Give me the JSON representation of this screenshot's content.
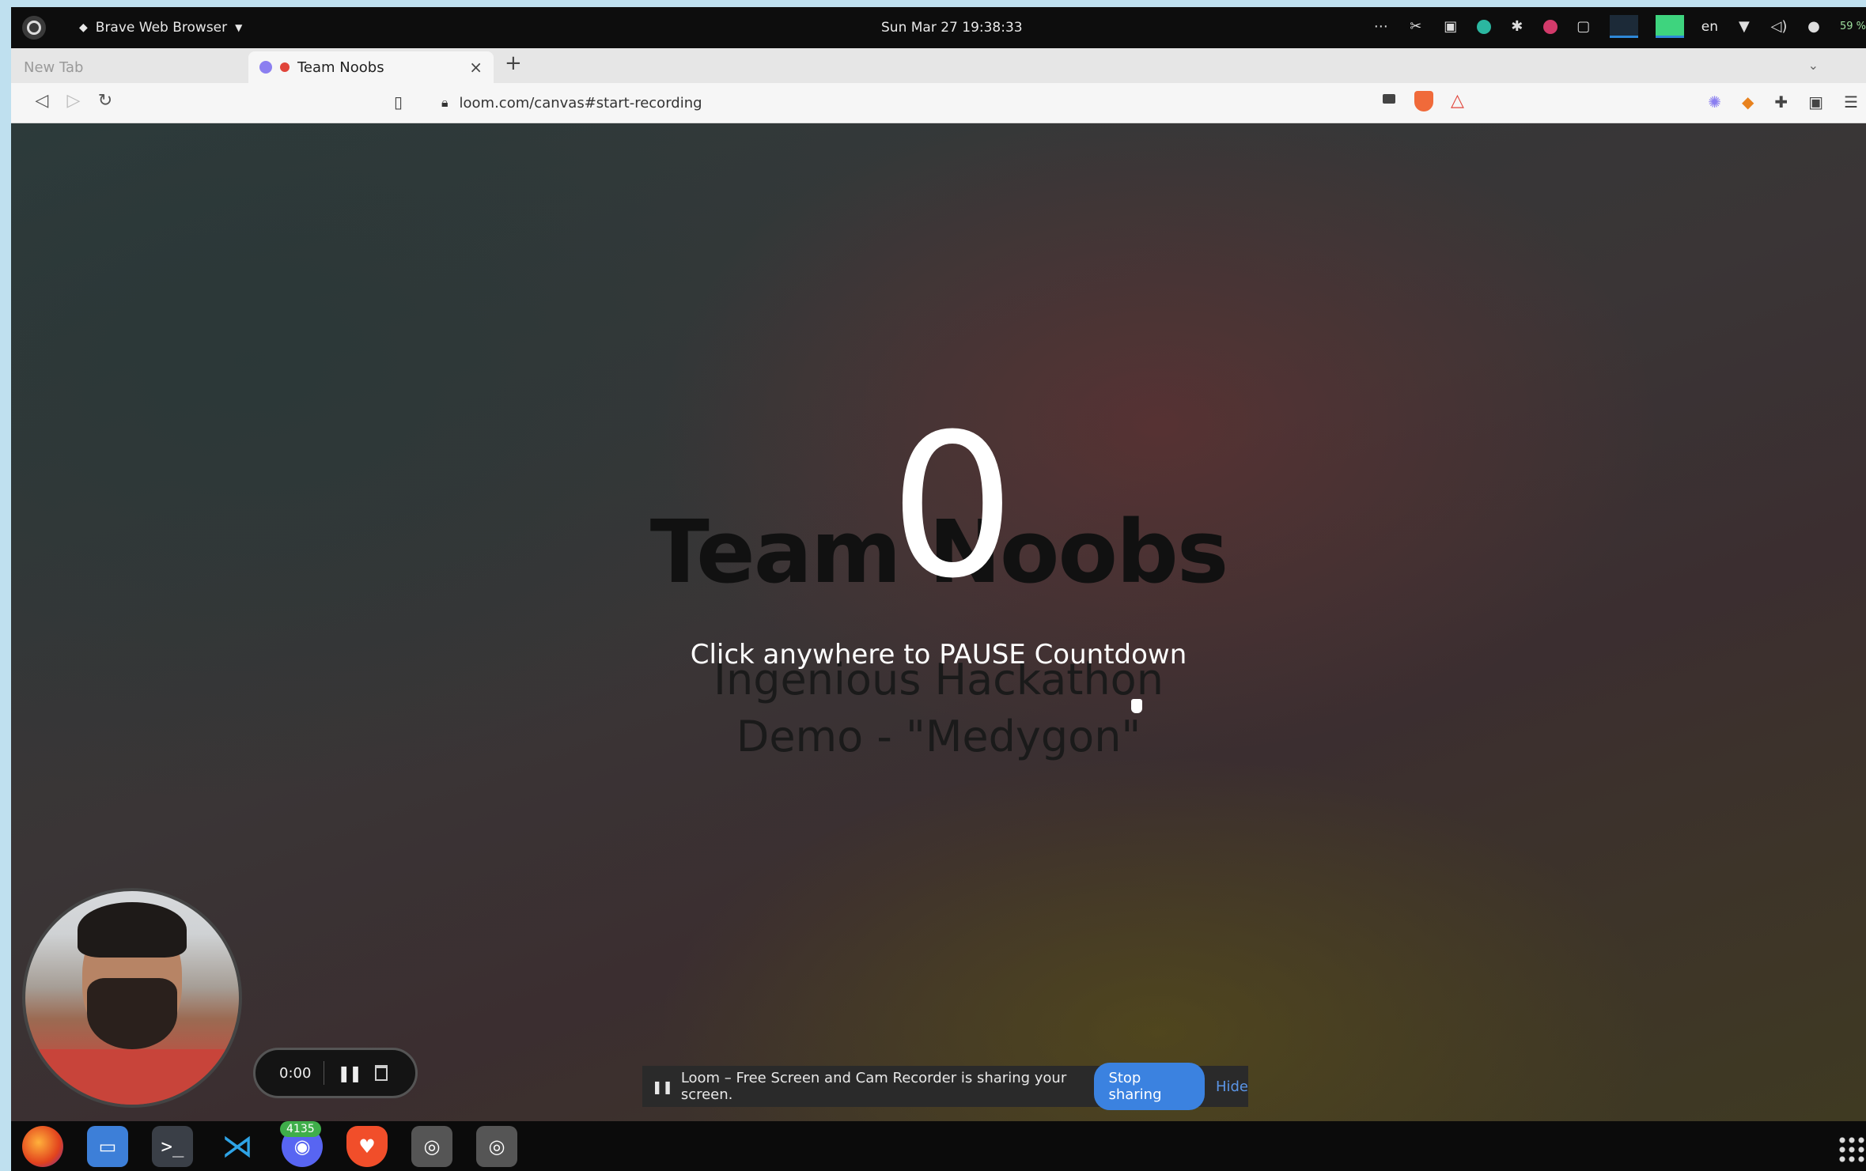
{
  "topbar": {
    "app_name": "Brave Web Browser",
    "clock": "Sun Mar 27  19:38:33",
    "language": "en",
    "battery": "59 %"
  },
  "browser": {
    "tabs": [
      {
        "label": "New Tab",
        "active": false
      },
      {
        "label": "Team Noobs",
        "active": true
      }
    ],
    "tab_close": "×",
    "new_tab": "+",
    "url": "loom.com/canvas#start-recording"
  },
  "slide": {
    "countdown": "0",
    "title": "Team Noobs",
    "subtitle_line1": "Ingenious Hackathon",
    "subtitle_line2": "Demo - \"Medygon\"",
    "pause_hint": "Click anywhere to PAUSE Countdown"
  },
  "recorder": {
    "time": "0:00"
  },
  "share_bar": {
    "message": "Loom – Free Screen and Cam Recorder is sharing your screen.",
    "stop_label": "Stop sharing",
    "hide_label": "Hide"
  },
  "dock": {
    "badge_count": "4135"
  },
  "colors": {
    "accent_blue": "#3b82e0",
    "record_red": "#e0443a"
  }
}
